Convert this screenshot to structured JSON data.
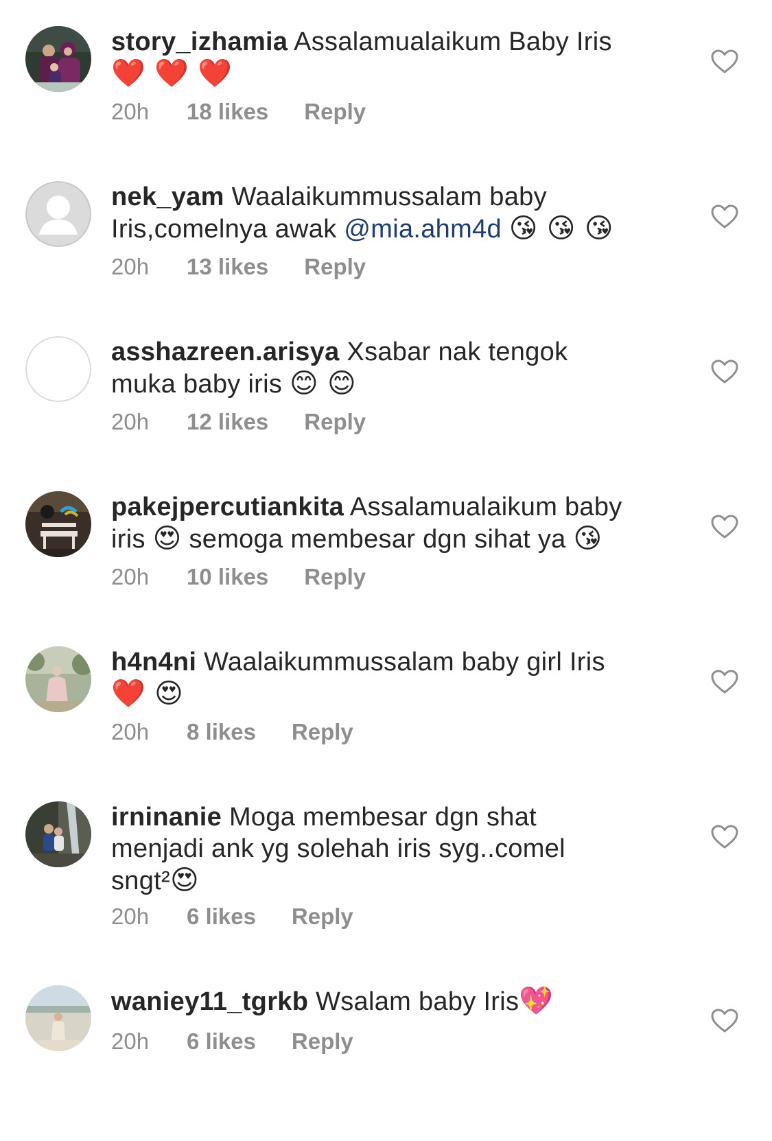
{
  "comments": [
    {
      "username": "story_izhamia",
      "text": "Assalamualaikum Baby Iris",
      "line2": "❤️ ❤️ ❤️",
      "time": "20h",
      "likes": "18 likes",
      "reply": "Reply"
    },
    {
      "username": "nek_yam",
      "text": "Waalaikummussalam baby",
      "line2": "Iris,comelnya awak",
      "mention": "@mia.ahm4d",
      "emoji": "😘 😘 😘",
      "time": "20h",
      "likes": "13 likes",
      "reply": "Reply"
    },
    {
      "username": "asshazreen.arisya",
      "text": "Xsabar nak tengok",
      "line2": "muka baby iris",
      "emoji": "😊 😊",
      "time": "20h",
      "likes": "12 likes",
      "reply": "Reply"
    },
    {
      "username": "pakejpercutiankita",
      "text": "Assalamualaikum baby",
      "line2a": "iris",
      "emoji_a": "😍",
      "line2b": "semoga membesar dgn sihat ya",
      "emoji_b": "😘",
      "time": "20h",
      "likes": "10 likes",
      "reply": "Reply"
    },
    {
      "username": "h4n4ni",
      "text": "Waalaikummussalam baby girl Iris",
      "line2": "❤️ 😍",
      "time": "20h",
      "likes": "8 likes",
      "reply": "Reply"
    },
    {
      "username": "irninanie",
      "text": "Moga membesar dgn shat",
      "line2": "menjadi ank yg solehah iris syg..comel",
      "line3": "sngt²",
      "emoji": "😍",
      "time": "20h",
      "likes": "6 likes",
      "reply": "Reply"
    },
    {
      "username": "waniey11_tgrkb",
      "text": "Wsalam baby Iris",
      "emoji": "💖",
      "time": "20h",
      "likes": "6 likes",
      "reply": "Reply"
    }
  ],
  "icons": {
    "like": "heart-outline-icon",
    "avatar_placeholder": "user-silhouette-icon"
  },
  "colors": {
    "text": "#262626",
    "meta": "#8e8e8e",
    "mention": "#1f3e6e",
    "heart_stroke": "#8e8e8e"
  }
}
